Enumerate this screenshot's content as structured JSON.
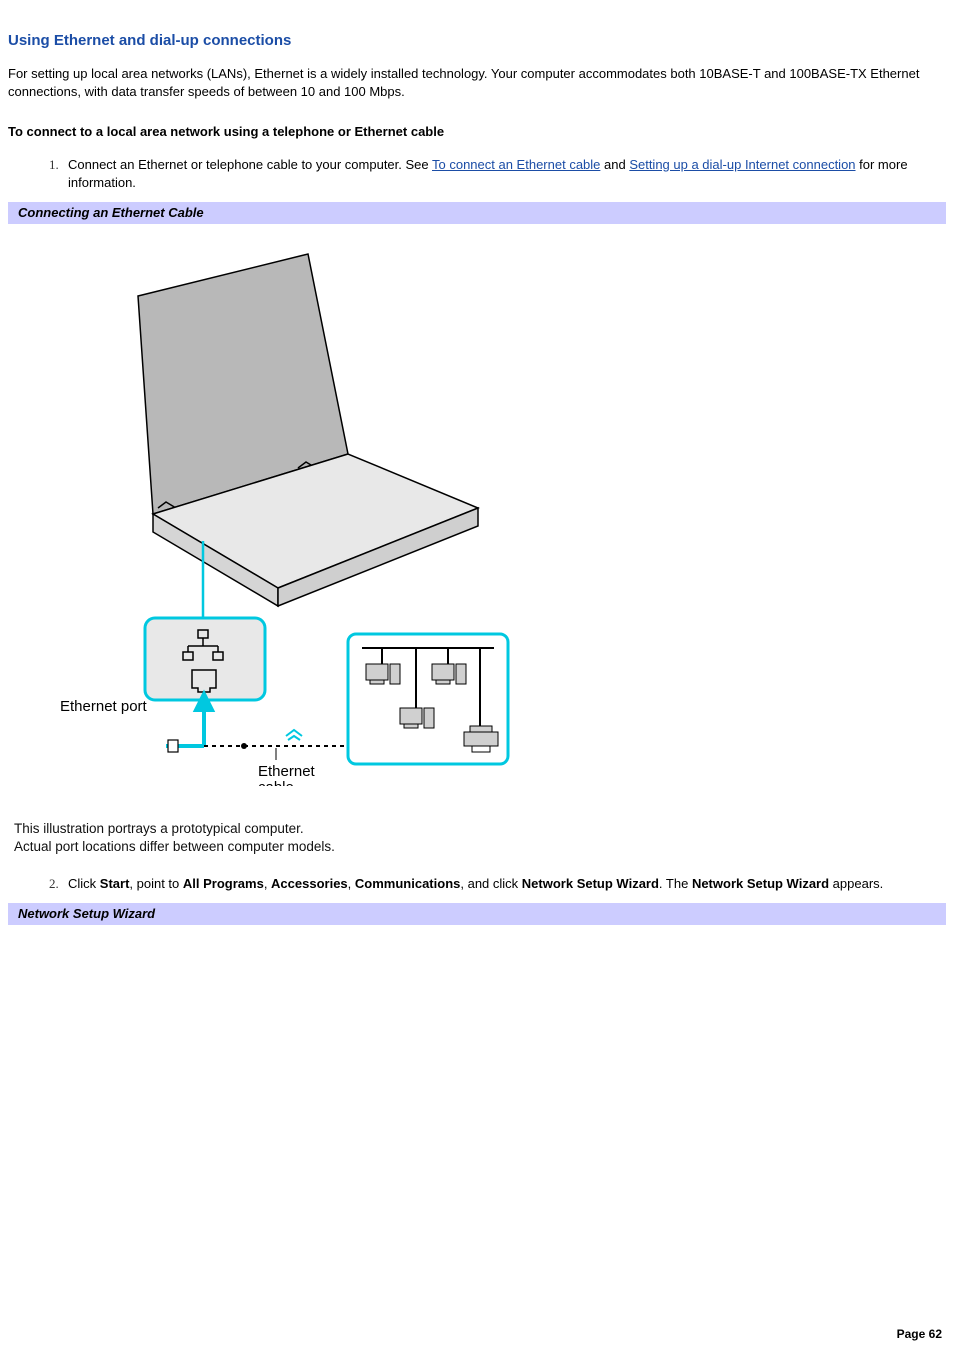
{
  "title": "Using Ethernet and dial-up connections",
  "intro": "For setting up local area networks (LANs), Ethernet is a widely installed technology. Your computer accommodates both 10BASE-T and 100BASE-TX Ethernet connections, with data transfer speeds of between 10 and 100 Mbps.",
  "subhead": "To connect to a local area network using a telephone or Ethernet cable",
  "steps": {
    "1": {
      "pre": "Connect an Ethernet or telephone cable to your computer. See ",
      "link1": "To connect an Ethernet cable",
      "mid": " and ",
      "link2": "Setting up a dial-up Internet connection",
      "post": " for more information."
    },
    "2": {
      "t0": "Click ",
      "b0": "Start",
      "t1": ", point to ",
      "b1": "All Programs",
      "t2": ", ",
      "b2": "Accessories",
      "t3": ", ",
      "b3": "Communications",
      "t4": ", and click ",
      "b4": "Network Setup Wizard",
      "t5": ". The ",
      "b5": "Network Setup Wizard",
      "t6": " appears."
    }
  },
  "band1": "Connecting an Ethernet Cable",
  "band2": "Network Setup Wizard",
  "figure": {
    "port_label": "Ethernet port",
    "cable_label_l1": "Ethernet",
    "cable_label_l2": "cable"
  },
  "caption_l1": "This illustration portrays a prototypical computer.",
  "caption_l2": "Actual port locations differ between computer models.",
  "page_footer": "Page 62"
}
